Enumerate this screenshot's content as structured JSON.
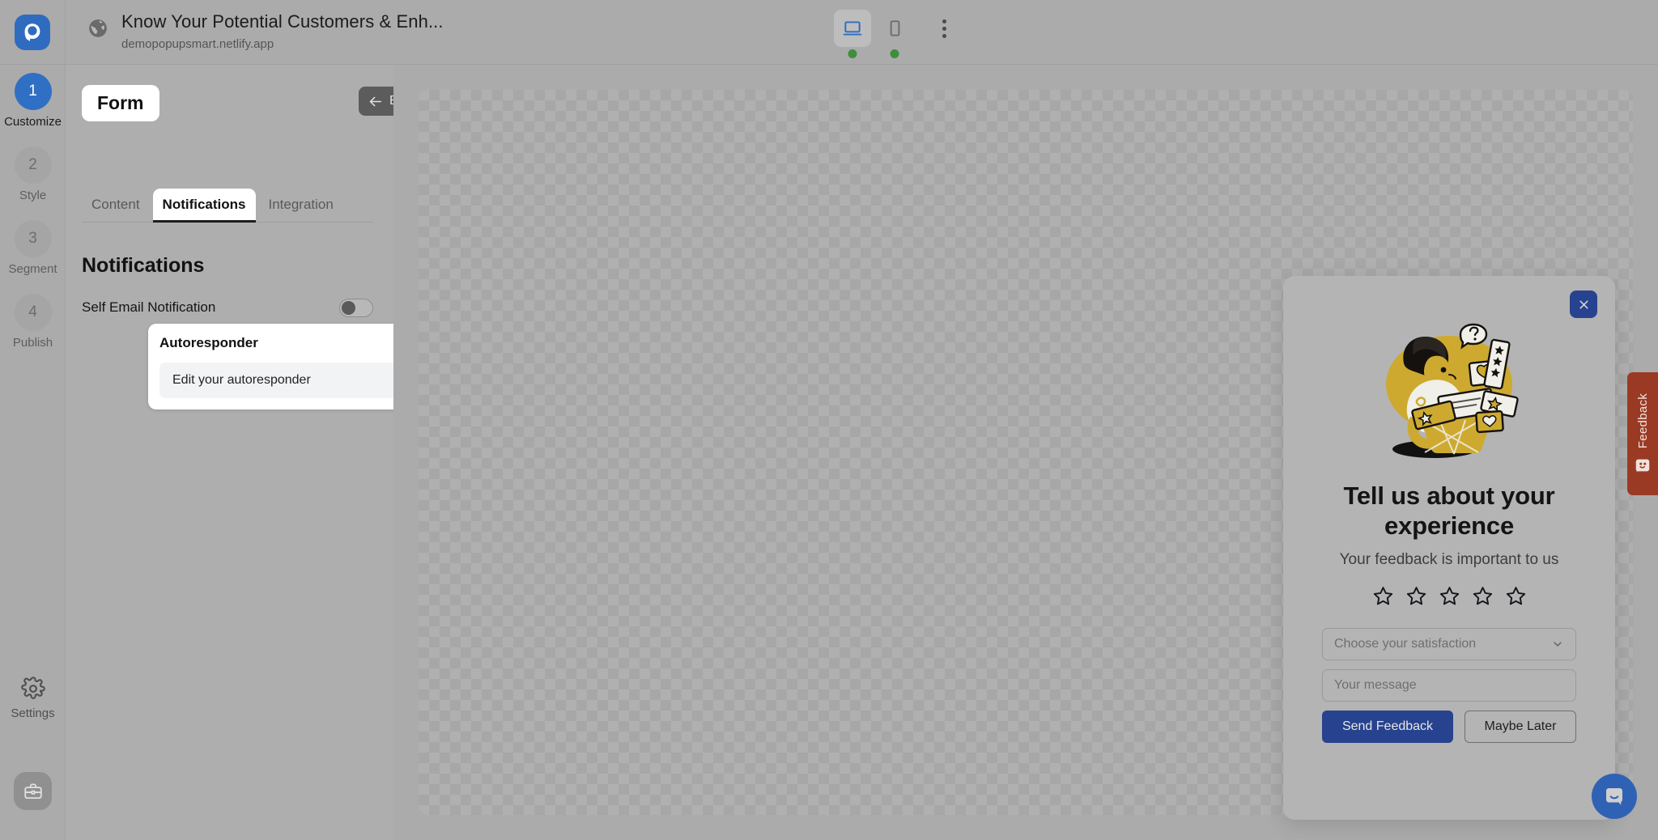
{
  "browser": {
    "site_title": "Know Your Potential Customers & Enh...",
    "site_url": "demopopupsmart.netlify.app",
    "logo_name": "popupsmart-logo",
    "globe_icon": "globe-icon",
    "devices": [
      {
        "name": "desktop",
        "icon": "desktop-icon",
        "active": true,
        "status": "online"
      },
      {
        "name": "mobile",
        "icon": "mobile-icon",
        "active": false,
        "status": "online"
      }
    ],
    "more_icon": "kebab-menu-icon",
    "status_dot_color": "#3d8f3d"
  },
  "rail": {
    "steps": [
      {
        "number": "1",
        "label": "Customize",
        "active": true
      },
      {
        "number": "2",
        "label": "Style",
        "active": false
      },
      {
        "number": "3",
        "label": "Segment",
        "active": false
      },
      {
        "number": "4",
        "label": "Publish",
        "active": false
      }
    ],
    "settings_label": "Settings",
    "settings_icon": "gear-icon",
    "workspace_icon": "briefcase-icon",
    "active_color": "#3070c4"
  },
  "panel": {
    "form_chip": "Form",
    "back_label": "Back",
    "back_icon": "arrow-left-icon",
    "tabs": [
      {
        "label": "Content",
        "active": false
      },
      {
        "label": "Notifications",
        "active": true
      },
      {
        "label": "Integration",
        "active": false
      }
    ],
    "section_title": "Notifications",
    "self_email": {
      "label": "Self Email Notification",
      "state": "off"
    },
    "autoresponder": {
      "label": "Autoresponder",
      "state": "on",
      "edit_label": "Edit your autoresponder",
      "edit_icon": "pencil-icon"
    },
    "toggle_on_color": "#3b8ae8"
  },
  "popup": {
    "close_icon": "close-icon",
    "illustration": "feedback-illustration",
    "heading": "Tell us about your experience",
    "subheading": "Your feedback is important to us",
    "star_count": 5,
    "star_icon": "star-outline-icon",
    "select_placeholder": "Choose your satisfaction",
    "select_icon": "chevron-down-icon",
    "message_placeholder": "Your message",
    "primary_button": "Send Feedback",
    "secondary_button": "Maybe Later",
    "accent_color": "#27438f"
  },
  "widgets": {
    "feedback_label": "Feedback",
    "feedback_icon": "smiley-face-icon",
    "feedback_color": "#9b3a24",
    "chat_icon": "chat-bubble-icon",
    "chat_color": "#2f62b5"
  }
}
